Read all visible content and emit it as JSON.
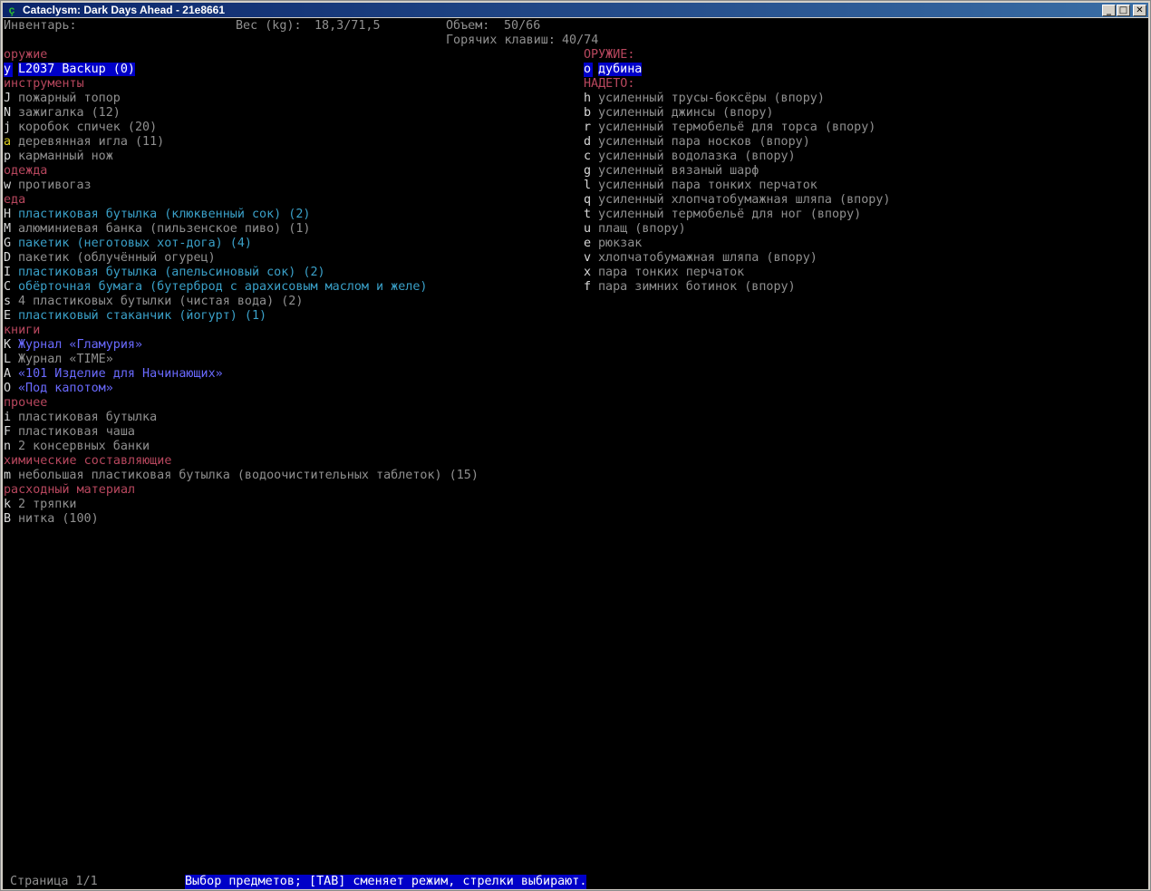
{
  "window": {
    "title": "Cataclysm: Dark Days Ahead - 21e8661",
    "btn_min": "_",
    "btn_max": "□",
    "btn_close": "✕",
    "icon": "app-icon"
  },
  "header": {
    "inventory_label": "Инвентарь:",
    "weight_label": "Вес (kg):",
    "weight_value": "18,3/71,5",
    "volume_label": "Объем:",
    "volume_value": "50/66",
    "hotkeys_label": "Горячих клавиш:",
    "hotkeys_value": "40/74"
  },
  "left": [
    {
      "type": "cat",
      "text": "оружие"
    },
    {
      "type": "item",
      "key": "y",
      "text": "L2037 Backup (0)",
      "color": "white",
      "selected": true
    },
    {
      "type": "cat",
      "text": "инструменты"
    },
    {
      "type": "item",
      "key": "J",
      "text": "пожарный топор",
      "color": "gray"
    },
    {
      "type": "item",
      "key": "N",
      "text": "зажигалка (12)",
      "color": "gray"
    },
    {
      "type": "item",
      "key": "j",
      "text": "коробок спичек (20)",
      "color": "gray"
    },
    {
      "type": "item",
      "key": "a",
      "text": "деревянная игла (11)",
      "color": "gray",
      "keycolor": "yellow"
    },
    {
      "type": "item",
      "key": "p",
      "text": "карманный нож",
      "color": "gray"
    },
    {
      "type": "cat",
      "text": "одежда"
    },
    {
      "type": "item",
      "key": "w",
      "text": "противогаз",
      "color": "gray"
    },
    {
      "type": "cat",
      "text": "еда"
    },
    {
      "type": "item",
      "key": "H",
      "text": "пластиковая бутылка (клюквенный сок) (2)",
      "color": "cyan"
    },
    {
      "type": "item",
      "key": "M",
      "text": "алюминиевая банка (пильзенское пиво) (1)",
      "color": "gray"
    },
    {
      "type": "item",
      "key": "G",
      "text": "пакетик (неготовых хот-дога) (4)",
      "color": "cyan"
    },
    {
      "type": "item",
      "key": "D",
      "text": "пакетик (облучённый огурец)",
      "color": "gray"
    },
    {
      "type": "item",
      "key": "I",
      "text": "пластиковая бутылка (апельсиновый сок) (2)",
      "color": "cyan"
    },
    {
      "type": "item",
      "key": "C",
      "text": "обёрточная бумага (бутерброд с арахисовым маслом и желе)",
      "color": "cyan"
    },
    {
      "type": "item",
      "key": "s",
      "text": "4 пластиковых бутылки (чистая вода) (2)",
      "color": "gray"
    },
    {
      "type": "item",
      "key": "E",
      "text": "пластиковый стаканчик (йогурт) (1)",
      "color": "cyan"
    },
    {
      "type": "cat",
      "text": "книги"
    },
    {
      "type": "item",
      "key": "K",
      "text": "Журнал «Гламурия»",
      "color": "blue"
    },
    {
      "type": "item",
      "key": "L",
      "text": "Журнал «TIME»",
      "color": "gray"
    },
    {
      "type": "item",
      "key": "A",
      "text": "«101 Изделие для Начинающих»",
      "color": "blue"
    },
    {
      "type": "item",
      "key": "O",
      "text": "«Под капотом»",
      "color": "blue"
    },
    {
      "type": "cat",
      "text": "прочее"
    },
    {
      "type": "item",
      "key": "i",
      "text": "пластиковая бутылка",
      "color": "gray"
    },
    {
      "type": "item",
      "key": "F",
      "text": "пластиковая чаша",
      "color": "gray"
    },
    {
      "type": "item",
      "key": "n",
      "text": "2 консервных банки",
      "color": "gray"
    },
    {
      "type": "cat",
      "text": "химические составляющие"
    },
    {
      "type": "item",
      "key": "m",
      "text": "небольшая пластиковая бутылка (водоочистительных таблеток) (15)",
      "color": "gray"
    },
    {
      "type": "cat",
      "text": "расходный материал"
    },
    {
      "type": "item",
      "key": "k",
      "text": "2 тряпки",
      "color": "gray"
    },
    {
      "type": "item",
      "key": "B",
      "text": "нитка (100)",
      "color": "gray"
    }
  ],
  "right": [
    {
      "type": "cat",
      "text": "ОРУЖИЕ:"
    },
    {
      "type": "item",
      "key": "o",
      "text": "дубина",
      "color": "white",
      "selected": true
    },
    {
      "type": "cat",
      "text": "НАДЕТО:"
    },
    {
      "type": "item",
      "key": "h",
      "text": "усиленный трусы-боксёры (впору)",
      "color": "gray"
    },
    {
      "type": "item",
      "key": "b",
      "text": "усиленный джинсы (впору)",
      "color": "gray"
    },
    {
      "type": "item",
      "key": "r",
      "text": "усиленный термобельё для торса (впору)",
      "color": "gray"
    },
    {
      "type": "item",
      "key": "d",
      "text": "усиленный пара носков (впору)",
      "color": "gray"
    },
    {
      "type": "item",
      "key": "c",
      "text": "усиленный водолазка (впору)",
      "color": "gray"
    },
    {
      "type": "item",
      "key": "g",
      "text": "усиленный вязаный шарф",
      "color": "gray"
    },
    {
      "type": "item",
      "key": "l",
      "text": "усиленный пара тонких перчаток",
      "color": "gray"
    },
    {
      "type": "item",
      "key": "q",
      "text": "усиленный хлопчатобумажная шляпа (впору)",
      "color": "gray"
    },
    {
      "type": "item",
      "key": "t",
      "text": "усиленный термобельё для ног (впору)",
      "color": "gray"
    },
    {
      "type": "item",
      "key": "u",
      "text": "плащ (впору)",
      "color": "gray"
    },
    {
      "type": "item",
      "key": "e",
      "text": "рюкзак",
      "color": "gray"
    },
    {
      "type": "item",
      "key": "v",
      "text": "хлопчатобумажная шляпа (впору)",
      "color": "gray"
    },
    {
      "type": "item",
      "key": "x",
      "text": "пара тонких перчаток",
      "color": "gray"
    },
    {
      "type": "item",
      "key": "f",
      "text": "пара зимних ботинок (впору)",
      "color": "gray"
    }
  ],
  "footer": {
    "page_label": "Страница 1/1",
    "hint": "Выбор предметов; [TAB] сменяет режим, стрелки выбирают."
  },
  "colors": {
    "background": "#000000",
    "category": "#b8475e",
    "highlight": "#0000c8",
    "cyan": "#3aa0c8",
    "blue": "#6a6aff",
    "yellow": "#e0d020"
  }
}
